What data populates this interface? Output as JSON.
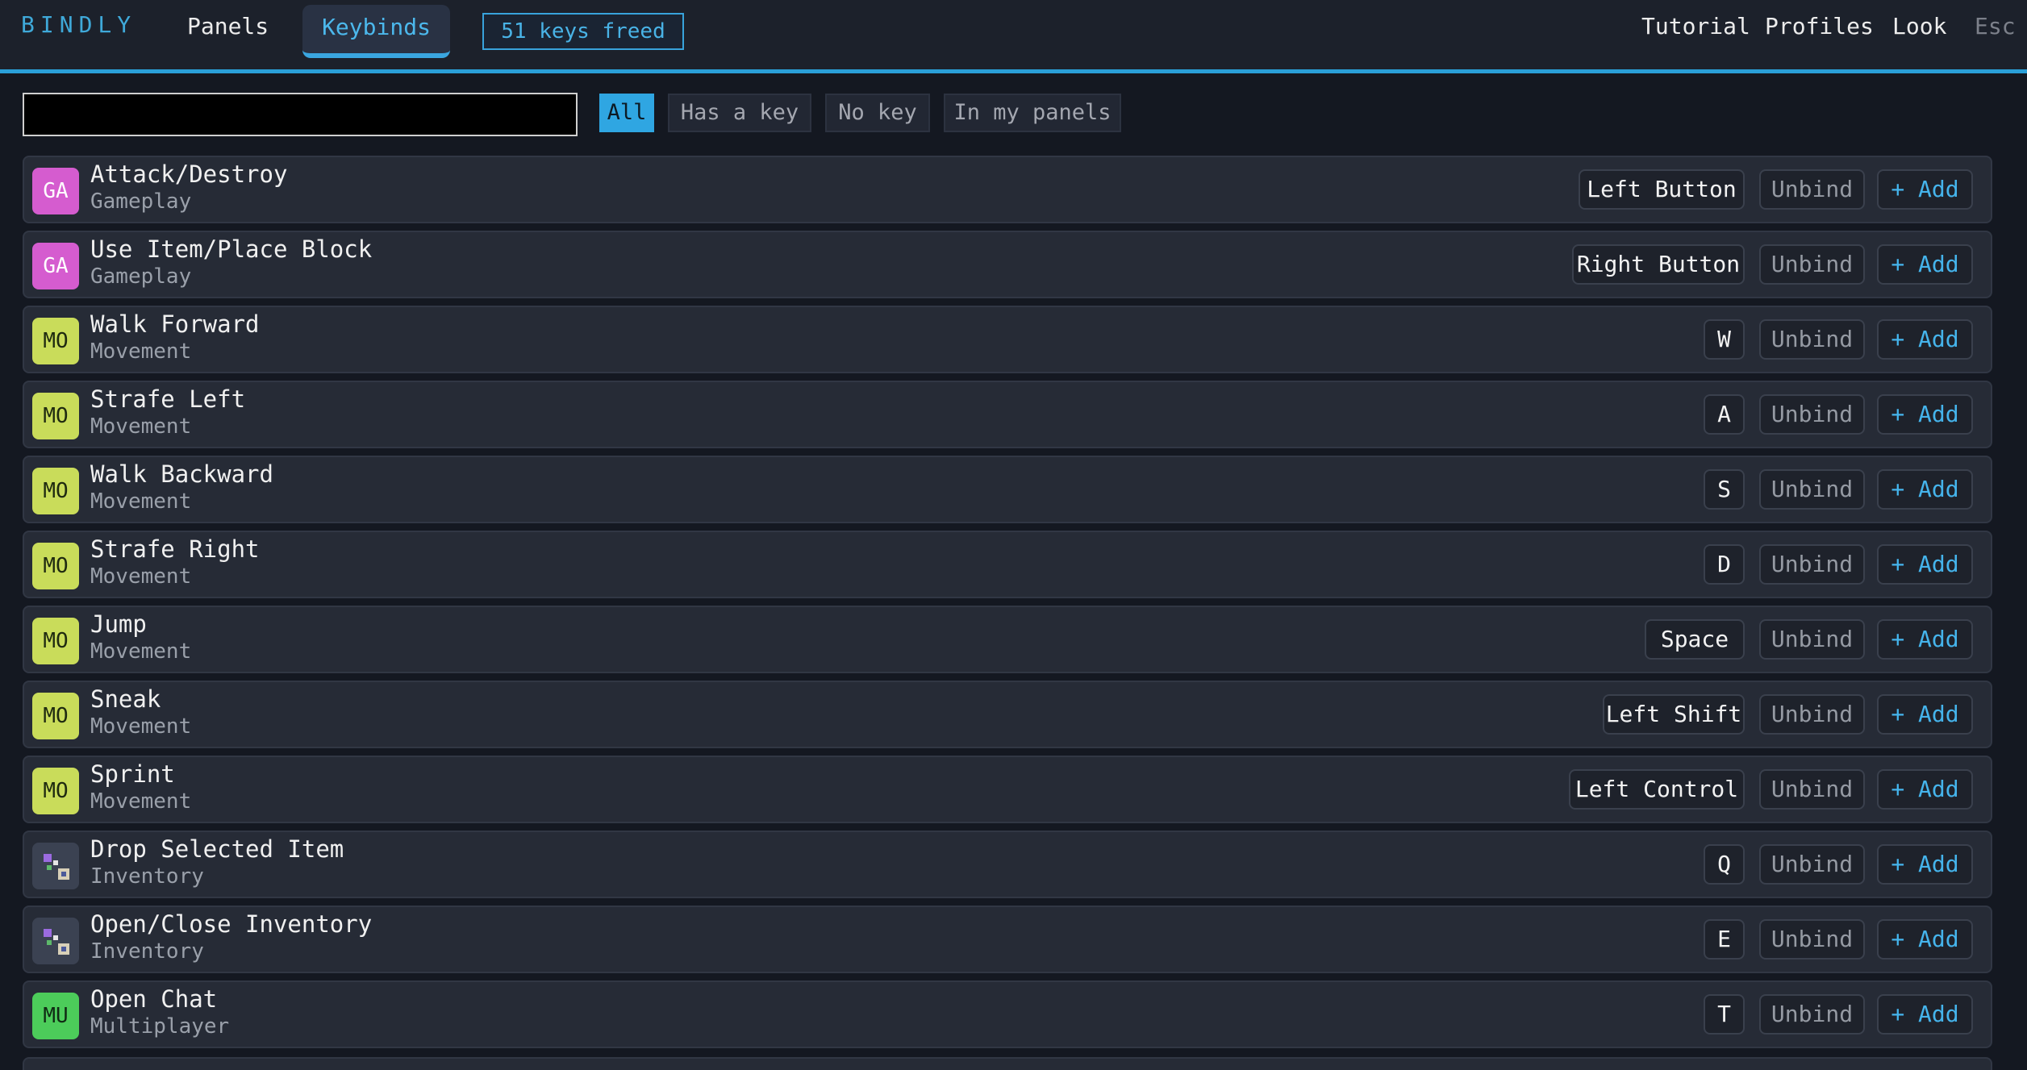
{
  "app": {
    "brand": "BINDLY"
  },
  "nav": {
    "panels": "Panels",
    "keybinds": "Keybinds",
    "freed": "51 keys freed"
  },
  "right_nav": {
    "tutorial": "Tutorial",
    "profiles": "Profiles",
    "look": "Look",
    "esc": "Esc"
  },
  "search": {
    "value": "",
    "placeholder": ""
  },
  "filters": {
    "all": "All",
    "has_key": "Has a key",
    "no_key": "No key",
    "in_panels": "In my panels"
  },
  "rows": [
    {
      "badge": "GA",
      "title": "Attack/Destroy",
      "category": "Gameplay",
      "key": "Left Button",
      "unbind": "Unbind",
      "add": "+ Add"
    },
    {
      "badge": "GA",
      "title": "Use Item/Place Block",
      "category": "Gameplay",
      "key": "Right Button",
      "unbind": "Unbind",
      "add": "+ Add"
    },
    {
      "badge": "MO",
      "title": "Walk Forward",
      "category": "Movement",
      "key": "W",
      "unbind": "Unbind",
      "add": "+ Add"
    },
    {
      "badge": "MO",
      "title": "Strafe Left",
      "category": "Movement",
      "key": "A",
      "unbind": "Unbind",
      "add": "+ Add"
    },
    {
      "badge": "MO",
      "title": "Walk Backward",
      "category": "Movement",
      "key": "S",
      "unbind": "Unbind",
      "add": "+ Add"
    },
    {
      "badge": "MO",
      "title": "Strafe Right",
      "category": "Movement",
      "key": "D",
      "unbind": "Unbind",
      "add": "+ Add"
    },
    {
      "badge": "MO",
      "title": "Jump",
      "category": "Movement",
      "key": "Space",
      "unbind": "Unbind",
      "add": "+ Add"
    },
    {
      "badge": "MO",
      "title": "Sneak",
      "category": "Movement",
      "key": "Left Shift",
      "unbind": "Unbind",
      "add": "+ Add"
    },
    {
      "badge": "MO",
      "title": "Sprint",
      "category": "Movement",
      "key": "Left Control",
      "unbind": "Unbind",
      "add": "+ Add"
    },
    {
      "badge": "",
      "icon": "inventory-icon",
      "title": "Drop Selected Item",
      "category": "Inventory",
      "key": "Q",
      "unbind": "Unbind",
      "add": "+ Add"
    },
    {
      "badge": "",
      "icon": "inventory-icon",
      "title": "Open/Close Inventory",
      "category": "Inventory",
      "key": "E",
      "unbind": "Unbind",
      "add": "+ Add"
    },
    {
      "badge": "MU",
      "title": "Open Chat",
      "category": "Multiplayer",
      "key": "T",
      "unbind": "Unbind",
      "add": "+ Add"
    }
  ],
  "colors": {
    "accent": "#2fa6e2",
    "gameplay": "#d55ccf",
    "movement": "#c9dc5a",
    "multiplayer": "#4ccc5a"
  }
}
